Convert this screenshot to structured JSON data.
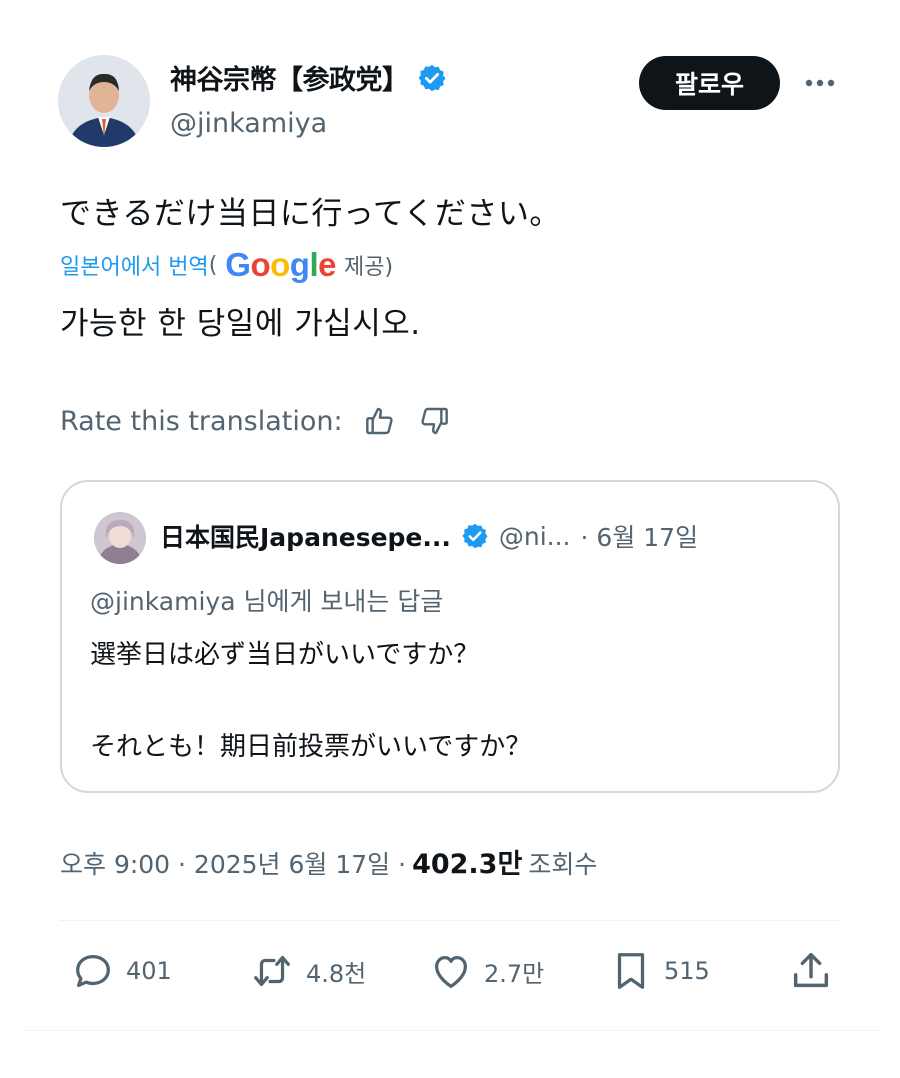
{
  "author": {
    "display_name": "神谷宗幣【参政党】",
    "handle": "@jinkamiya",
    "verified": true,
    "follow_label": "팔로우",
    "more_icon": "more-horizontal-icon"
  },
  "tweet": {
    "text": "できるだけ当日に行ってください。",
    "translated_from": "일본어에서 번역",
    "translated_paren_open": "(",
    "google": "Google",
    "provided_by": "제공)",
    "translation": "가능한 한 당일에 가십시오.",
    "rate_label": "Rate this translation:"
  },
  "quote": {
    "display_name": "日本国民Japanesepe...",
    "handle": "@ni...",
    "date": "· 6월 17일",
    "reply_to_handle": "@jinkamiya",
    "reply_to_suffix": "님에게 보내는 답글",
    "line1": "選挙日は必ず当日がいいですか？",
    "line2": "それとも！期日前投票がいいですか？"
  },
  "meta": {
    "time_date": "오후 9:00 · 2025년 6월 17일 ·",
    "views_count": "402.3만",
    "views_label": "조회수"
  },
  "actions": {
    "replies": "401",
    "reposts": "4.8천",
    "likes": "2.7만",
    "bookmarks": "515"
  },
  "colors": {
    "verified": "#1d9bf0",
    "link": "#1d9bf0",
    "secondary_text": "#536471"
  }
}
